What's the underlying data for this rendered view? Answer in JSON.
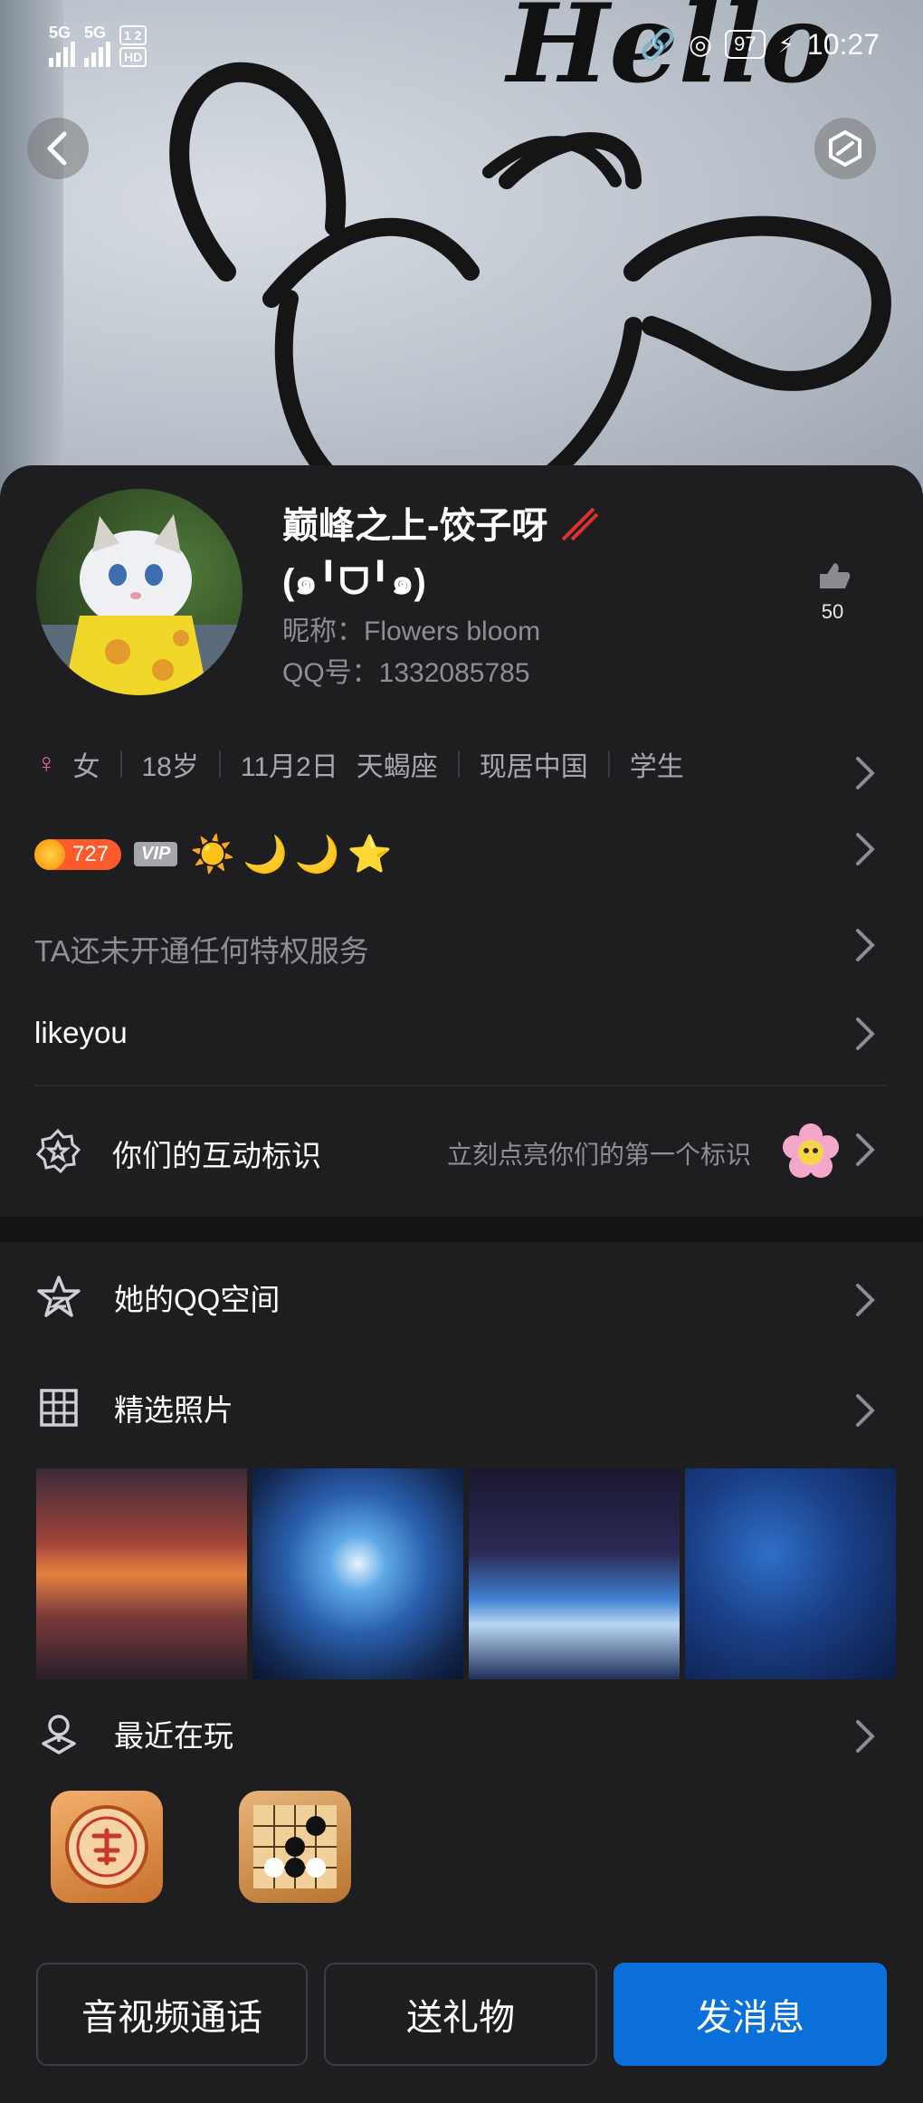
{
  "status_bar": {
    "signal1": "5G",
    "signal2": "5G",
    "hd_badge_top": "1 2",
    "hd_badge_bottom": "HD",
    "battery": "97",
    "time": "10:27"
  },
  "header": {
    "back_icon": "chevron-left-icon",
    "share_icon": "hexagon-share-icon",
    "cover_text": "Hello"
  },
  "profile": {
    "name_line1": "巅峰之上-饺子呀",
    "name_line2": "(๑╹ᗜ╹๑)",
    "nickname": "昵称：Flowers bloom",
    "qq_number": "QQ号：1332085785",
    "likes_count": "50"
  },
  "info": {
    "gender_symbol": "♀",
    "gender": "女",
    "age": "18岁",
    "birthday": "11月2日",
    "zodiac": "天蝎座",
    "location": "现居中国",
    "occupation": "学生"
  },
  "level": {
    "badge_value": "727",
    "vip_label": "VIP",
    "grade_icons": [
      "☀️",
      "🌙",
      "🌙",
      "⭐"
    ]
  },
  "privilege_text": "TA还未开通任何特权服务",
  "signature": "likeyou",
  "interaction": {
    "label": "你们的互动标识",
    "hint": "立刻点亮你们的第一个标识"
  },
  "menu": {
    "qzone": "她的QQ空间",
    "photos": "精选照片",
    "recent_games": "最近在玩"
  },
  "buttons": {
    "call": "音视频通话",
    "gift": "送礼物",
    "message": "发消息"
  },
  "colors": {
    "primary_button": "#0a6fd8",
    "background": "#1e1e20",
    "level_badge": "#ff5a2a"
  }
}
